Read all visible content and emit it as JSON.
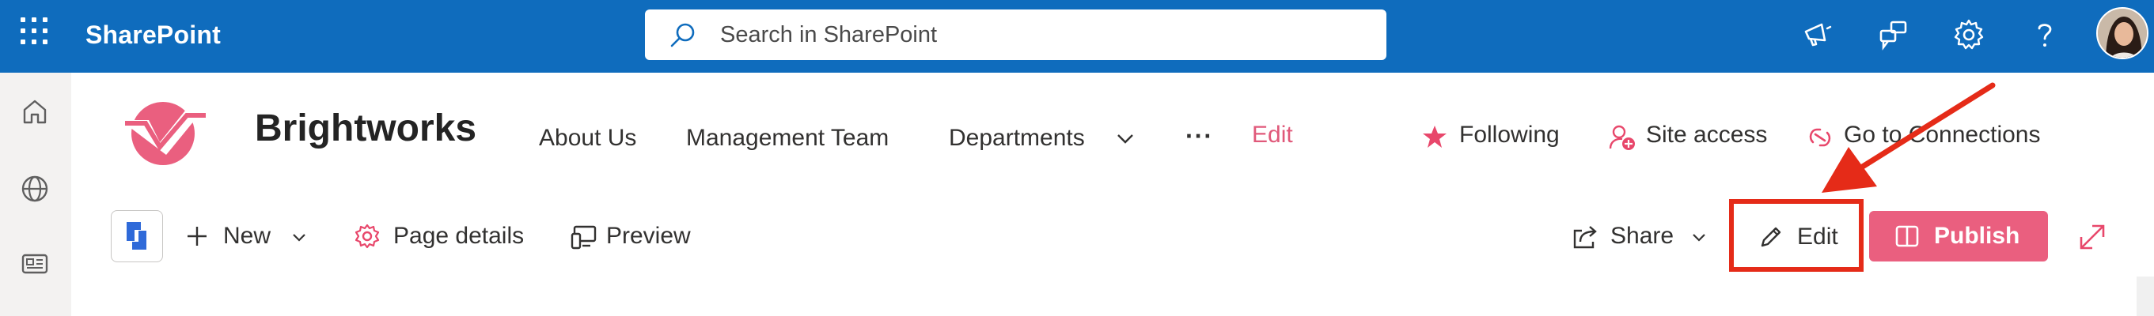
{
  "suite": {
    "app_name": "SharePoint",
    "search_placeholder": "Search in SharePoint"
  },
  "site": {
    "title": "Brightworks",
    "nav": [
      "About Us",
      "Management Team",
      "Departments",
      "Edit"
    ],
    "following_label": "Following",
    "site_access_label": "Site access",
    "connections_label": "Go to Connections"
  },
  "commandbar": {
    "new_label": "New",
    "page_details_label": "Page details",
    "preview_label": "Preview",
    "share_label": "Share",
    "edit_label": "Edit",
    "publish_label": "Publish"
  },
  "colors": {
    "suitebar": "#0f6cbd",
    "accent": "#ea5f7f",
    "highlight": "#e52b18"
  }
}
